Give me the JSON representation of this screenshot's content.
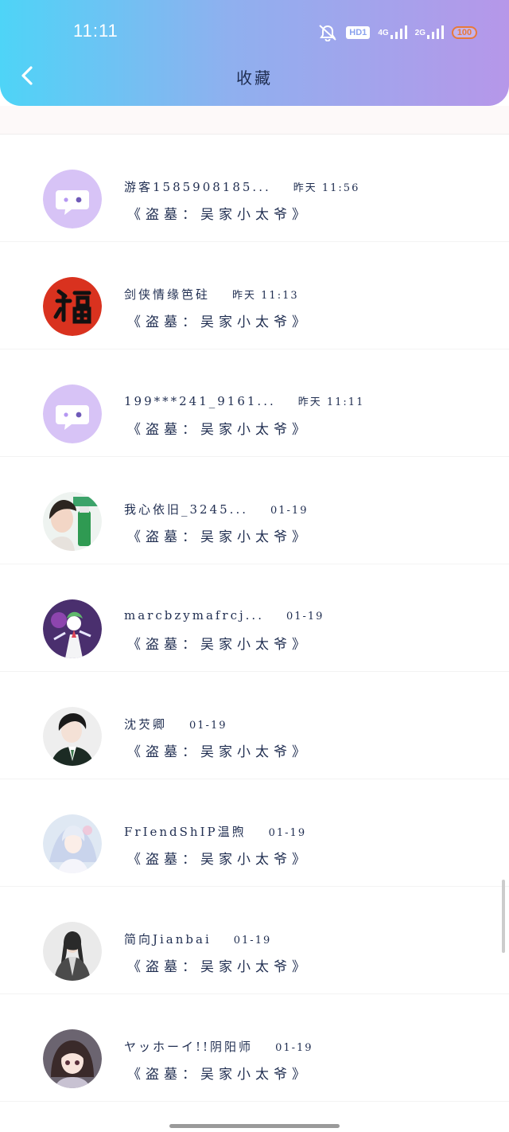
{
  "status_bar": {
    "time": "11:11",
    "hd_label": "HD1",
    "net1": "4G",
    "net2": "2G",
    "battery": "100"
  },
  "header": {
    "title": "收藏",
    "back_icon": "chevron-left-icon",
    "gradient": [
      "#4ed4f7",
      "#b697e9"
    ]
  },
  "items": [
    {
      "name": "游客1585908185...",
      "time": "昨天 11:56",
      "text": "《盗墓：吴家小太爷》",
      "avatar": "default-chat-avatar"
    },
    {
      "name": "剑侠情缘笆砫",
      "time": "昨天 11:13",
      "text": "《盗墓：吴家小太爷》",
      "avatar": "fu-character-avatar"
    },
    {
      "name": "199***241_9161...",
      "time": "昨天 11:11",
      "text": "《盗墓：吴家小太爷》",
      "avatar": "default-chat-avatar"
    },
    {
      "name": "我心依旧_3245...",
      "time": "01-19",
      "text": "《盗墓：吴家小太爷》",
      "avatar": "woman-product-avatar"
    },
    {
      "name": "marcbzymafrcj...",
      "time": "01-19",
      "text": "《盗墓：吴家小太爷》",
      "avatar": "pokemon-avatar"
    },
    {
      "name": "沈芡卿",
      "time": "01-19",
      "text": "《盗墓：吴家小太爷》",
      "avatar": "anime-boy-avatar"
    },
    {
      "name": "FrIendShIP温煦",
      "time": "01-19",
      "text": "《盗墓：吴家小太爷》",
      "avatar": "anime-girl-avatar"
    },
    {
      "name": "简向Jianbai",
      "time": "01-19",
      "text": "《盗墓：吴家小太爷》",
      "avatar": "ancient-man-avatar"
    },
    {
      "name": "ヤッホーイ!!阴阳师",
      "time": "01-19",
      "text": "《盗墓：吴家小太爷》",
      "avatar": "chibi-girl-avatar"
    }
  ]
}
